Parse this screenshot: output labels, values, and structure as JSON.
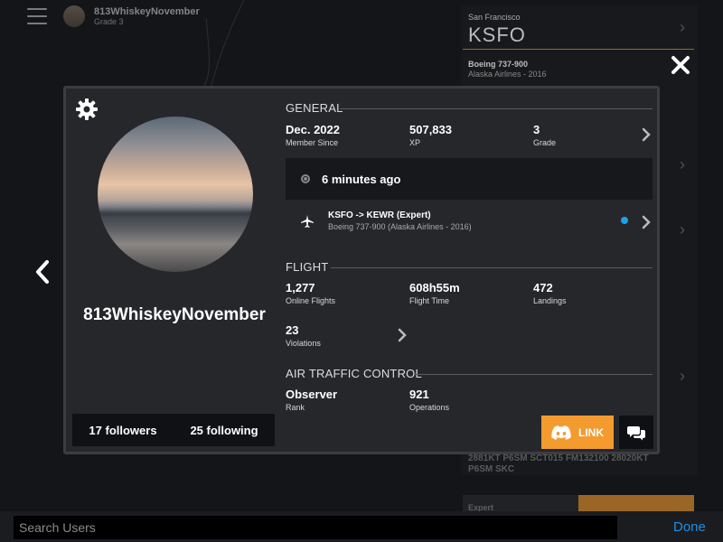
{
  "background": {
    "user": {
      "name": "813WhiskeyNovember",
      "grade": "Grade 3"
    },
    "panel": {
      "city": "San Francisco",
      "code": "KSFO",
      "aircraft": "Boeing 737-900",
      "airline": "Alaska Airlines - 2016",
      "metar_line1": "2881KT P6SM SCT015 FM132100 28020KT",
      "metar_line2": "P6SM SKC",
      "fly_label": "Expert"
    }
  },
  "profile": {
    "username": "813WhiskeyNovember",
    "followers": "17 followers",
    "following": "25 following"
  },
  "general": {
    "title": "GENERAL",
    "member_since_value": "Dec. 2022",
    "member_since_label": "Member Since",
    "xp_value": "507,833",
    "xp_label": "XP",
    "grade_value": "3",
    "grade_label": "Grade"
  },
  "status": {
    "last_seen": "6 minutes ago"
  },
  "current_flight": {
    "route": "KSFO -> KEWR (Expert)",
    "aircraft": "Boeing 737-900 (Alaska Airlines - 2016)"
  },
  "flight": {
    "title": "FLIGHT",
    "online_flights_value": "1,277",
    "online_flights_label": "Online Flights",
    "flight_time_value": "608h55m",
    "flight_time_label": "Flight Time",
    "landings_value": "472",
    "landings_label": "Landings",
    "violations_value": "23",
    "violations_label": "Violations"
  },
  "atc": {
    "title": "AIR TRAFFIC CONTROL",
    "rank_value": "Observer",
    "rank_label": "Rank",
    "operations_value": "921",
    "operations_label": "Operations"
  },
  "actions": {
    "link_label": "LINK"
  },
  "search": {
    "placeholder": "Search Users",
    "done_label": "Done"
  },
  "colors": {
    "accent": "#f39b2f",
    "live": "#1aa3e8",
    "done": "#1e8fe8"
  }
}
